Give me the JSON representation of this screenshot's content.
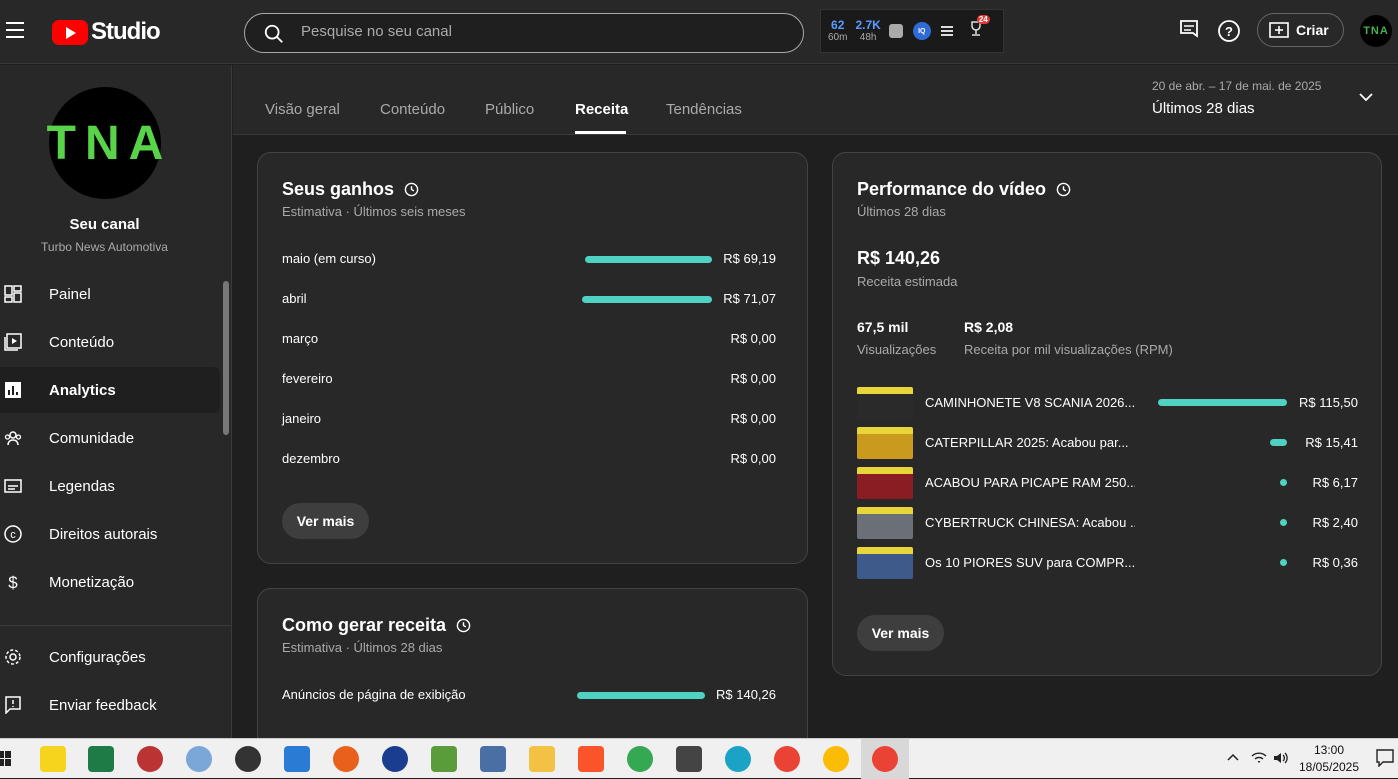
{
  "header": {
    "logo_text": "Studio",
    "search_placeholder": "Pesquise no seu canal",
    "ext_stats": [
      {
        "value": "62",
        "label": "60m"
      },
      {
        "value": "2.7K",
        "label": "48h"
      }
    ],
    "ext_iq": "IQ",
    "ext_badge": "24",
    "create_label": "Criar",
    "avatar_initials": "TNA"
  },
  "sidebar": {
    "avatar_initials": "TNA",
    "channel_title": "Seu canal",
    "channel_name": "Turbo News Automotiva",
    "items": [
      {
        "label": "Painel",
        "icon": "dashboard-icon"
      },
      {
        "label": "Conteúdo",
        "icon": "content-icon"
      },
      {
        "label": "Analytics",
        "icon": "analytics-icon"
      },
      {
        "label": "Comunidade",
        "icon": "community-icon"
      },
      {
        "label": "Legendas",
        "icon": "subtitles-icon"
      },
      {
        "label": "Direitos autorais",
        "icon": "copyright-icon"
      },
      {
        "label": "Monetização",
        "icon": "monetization-icon"
      }
    ],
    "bottom_items": [
      {
        "label": "Configurações",
        "icon": "settings-icon"
      },
      {
        "label": "Enviar feedback",
        "icon": "feedback-icon"
      }
    ],
    "active_item": "Analytics"
  },
  "tabs": {
    "items": [
      "Visão geral",
      "Conteúdo",
      "Público",
      "Receita",
      "Tendências"
    ],
    "active": "Receita"
  },
  "date_range": {
    "dates": "20 de abr. – 17 de mai. de 2025",
    "label": "Últimos 28 dias"
  },
  "earnings": {
    "title": "Seus ganhos",
    "subtitle": "Estimativa · Últimos seis meses",
    "rows": [
      {
        "month": "maio (em curso)",
        "value": "R$ 69,19",
        "amount": 69.19
      },
      {
        "month": "abril",
        "value": "R$ 71,07",
        "amount": 71.07
      },
      {
        "month": "março",
        "value": "R$ 0,00",
        "amount": 0
      },
      {
        "month": "fevereiro",
        "value": "R$ 0,00",
        "amount": 0
      },
      {
        "month": "janeiro",
        "value": "R$ 0,00",
        "amount": 0
      },
      {
        "month": "dezembro",
        "value": "R$ 0,00",
        "amount": 0
      }
    ],
    "more_label": "Ver mais"
  },
  "revenue_sources": {
    "title": "Como gerar receita",
    "subtitle": "Estimativa · Últimos 28 dias",
    "rows": [
      {
        "source": "Anúncios de página de exibição",
        "value": "R$ 140,26",
        "amount": 140.26
      }
    ]
  },
  "video_performance": {
    "title": "Performance do vídeo",
    "subtitle": "Últimos 28 dias",
    "total_revenue": "R$ 140,26",
    "total_revenue_label": "Receita estimada",
    "views": "67,5 mil",
    "views_label": "Visualizações",
    "rpm": "R$ 2,08",
    "rpm_label": "Receita por mil visualizações (RPM)",
    "videos": [
      {
        "title": "CAMINHONETE V8 SCANIA 2026...",
        "value": "R$ 115,50",
        "amount": 115.5,
        "thumb_color": "#2a2a2a"
      },
      {
        "title": "CATERPILLAR 2025: Acabou par...",
        "value": "R$ 15,41",
        "amount": 15.41,
        "thumb_color": "#c99a1e"
      },
      {
        "title": "ACABOU PARA PICAPE RAM 250...",
        "value": "R$ 6,17",
        "amount": 6.17,
        "thumb_color": "#8a1c24"
      },
      {
        "title": "CYBERTRUCK CHINESA: Acabou ...",
        "value": "R$ 2,40",
        "amount": 2.4,
        "thumb_color": "#6b6f78"
      },
      {
        "title": "Os 10 PIORES SUV para COMPR...",
        "value": "R$ 0,36",
        "amount": 0.36,
        "thumb_color": "#3d5a8a"
      }
    ],
    "more_label": "Ver mais"
  },
  "taskbar": {
    "time": "13:00",
    "date": "18/05/2025"
  },
  "colors": {
    "accent_bar": "#50d2c2",
    "brand_red": "#ff0000",
    "avatar_green": "#58d34a"
  }
}
